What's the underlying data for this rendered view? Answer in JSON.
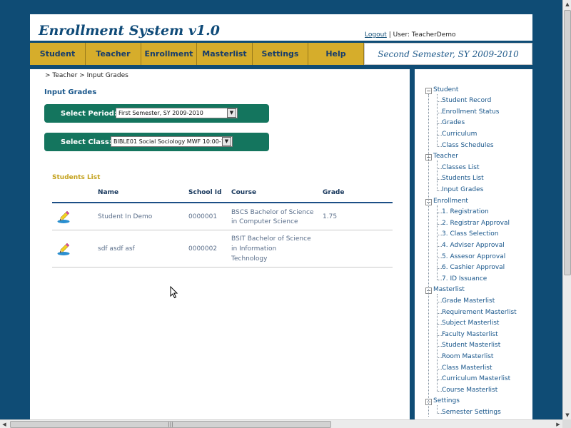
{
  "header": {
    "app_title": "Enrollment System v1.0",
    "logout_label": "Logout",
    "separator": "|",
    "user_label": "User: TeacherDemo"
  },
  "nav": {
    "items": [
      "Student",
      "Teacher",
      "Enrollment",
      "Masterlist",
      "Settings",
      "Help"
    ]
  },
  "semester_banner": "Second Semester, SY 2009-2010",
  "breadcrumb": "> Teacher > Input Grades",
  "page_title": "Input Grades",
  "period": {
    "label": "Select Period:",
    "value": "First Semester, SY 2009-2010"
  },
  "class": {
    "label": "Select Class:",
    "value": "BIBLE01 Social Sociology MWF 10:00-12"
  },
  "students_list": {
    "heading": "Students List",
    "columns": [
      "Name",
      "School Id",
      "Course",
      "Grade"
    ],
    "rows": [
      {
        "name": "Student In Demo",
        "school_id": "0000001",
        "course_lines": [
          "BSCS Bachelor of Science",
          "in Computer Science"
        ],
        "grade": "1.75"
      },
      {
        "name": "sdf asdf asf",
        "school_id": "0000002",
        "course_lines": [
          "BSIT Bachelor of Science",
          "in Information",
          "Technology"
        ],
        "grade": ""
      }
    ]
  },
  "sidebar": {
    "groups": [
      {
        "label": "Student",
        "items": [
          "Student Record",
          "Enrollment Status",
          "Grades",
          "Curriculum",
          "Class Schedules"
        ]
      },
      {
        "label": "Teacher",
        "items": [
          "Classes List",
          "Students List",
          "Input Grades"
        ]
      },
      {
        "label": "Enrollment",
        "items": [
          "1. Registration",
          "2. Registrar Approval",
          "3. Class Selection",
          "4. Adviser Approval",
          "5. Assesor Approval",
          "6. Cashier Approval",
          "7. ID Issuance"
        ]
      },
      {
        "label": "Masterlist",
        "items": [
          "Grade Masterlist",
          "Requirement Masterlist",
          "Subject Masterlist",
          "Faculty Masterlist",
          "Student Masterlist",
          "Room Masterlist",
          "Class Masterlist",
          "Curriculum Masterlist",
          "Course Masterlist"
        ]
      },
      {
        "label": "Settings",
        "items": [
          "Semester Settings"
        ]
      }
    ]
  },
  "colors": {
    "background": "#0f4c75",
    "nav_gold": "#d6ad2b",
    "select_green": "#14755e",
    "link_blue": "#17558a",
    "heading_gold": "#c4a21e"
  },
  "icons": {
    "edit_grade": "pencil-icon",
    "tree_toggle": "minus-box-icon",
    "cursor": "mouse-pointer-icon"
  }
}
